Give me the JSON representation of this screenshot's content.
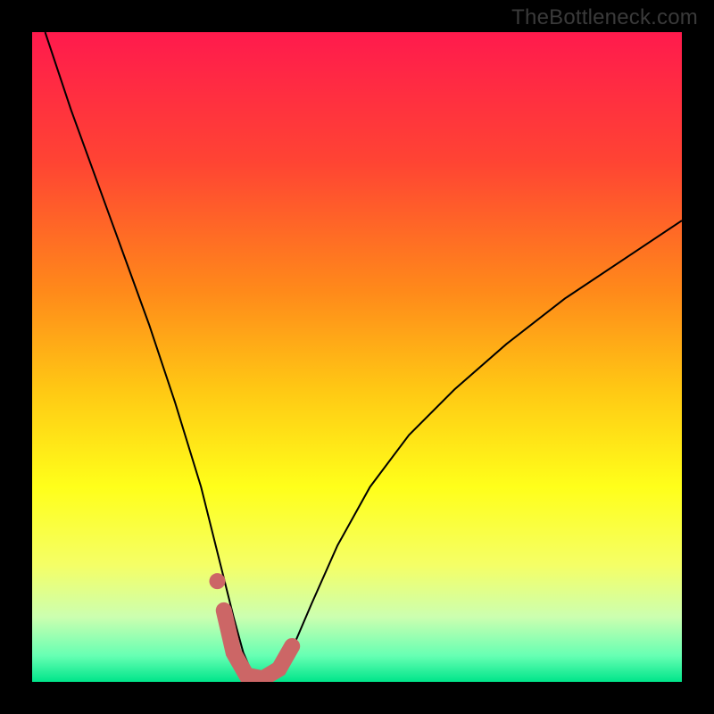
{
  "watermark": "TheBottleneck.com",
  "chart_data": {
    "type": "line",
    "title": "",
    "xlabel": "",
    "ylabel": "",
    "xlim": [
      0,
      1
    ],
    "ylim": [
      0,
      1
    ],
    "background": {
      "style": "vertical-gradient",
      "stops": [
        {
          "pos": 0.0,
          "color": "#ff1a4d"
        },
        {
          "pos": 0.2,
          "color": "#ff4433"
        },
        {
          "pos": 0.4,
          "color": "#ff8a1a"
        },
        {
          "pos": 0.55,
          "color": "#ffc814"
        },
        {
          "pos": 0.7,
          "color": "#ffff1a"
        },
        {
          "pos": 0.82,
          "color": "#f5ff66"
        },
        {
          "pos": 0.9,
          "color": "#ccffb0"
        },
        {
          "pos": 0.96,
          "color": "#66ffb3"
        },
        {
          "pos": 1.0,
          "color": "#00e58a"
        }
      ]
    },
    "series": [
      {
        "name": "bottleneck-curve",
        "stroke": "#000000",
        "stroke_width": 2,
        "x": [
          0.02,
          0.06,
          0.1,
          0.14,
          0.18,
          0.22,
          0.26,
          0.29,
          0.31,
          0.325,
          0.34,
          0.355,
          0.375,
          0.4,
          0.43,
          0.47,
          0.52,
          0.58,
          0.65,
          0.73,
          0.82,
          0.91,
          1.0
        ],
        "y": [
          1.0,
          0.88,
          0.77,
          0.66,
          0.55,
          0.43,
          0.3,
          0.18,
          0.1,
          0.045,
          0.01,
          0.005,
          0.01,
          0.05,
          0.12,
          0.21,
          0.3,
          0.38,
          0.45,
          0.52,
          0.59,
          0.65,
          0.71
        ]
      },
      {
        "name": "highlight-band",
        "stroke": "#cc6666",
        "stroke_width": 18,
        "linecap": "round",
        "x": [
          0.295,
          0.31,
          0.33,
          0.355,
          0.38,
          0.4
        ],
        "y": [
          0.11,
          0.045,
          0.01,
          0.005,
          0.02,
          0.055
        ]
      },
      {
        "name": "highlight-start-dot",
        "type": "scatter",
        "fill": "#cc6666",
        "r": 9,
        "x": [
          0.285
        ],
        "y": [
          0.155
        ]
      }
    ]
  }
}
